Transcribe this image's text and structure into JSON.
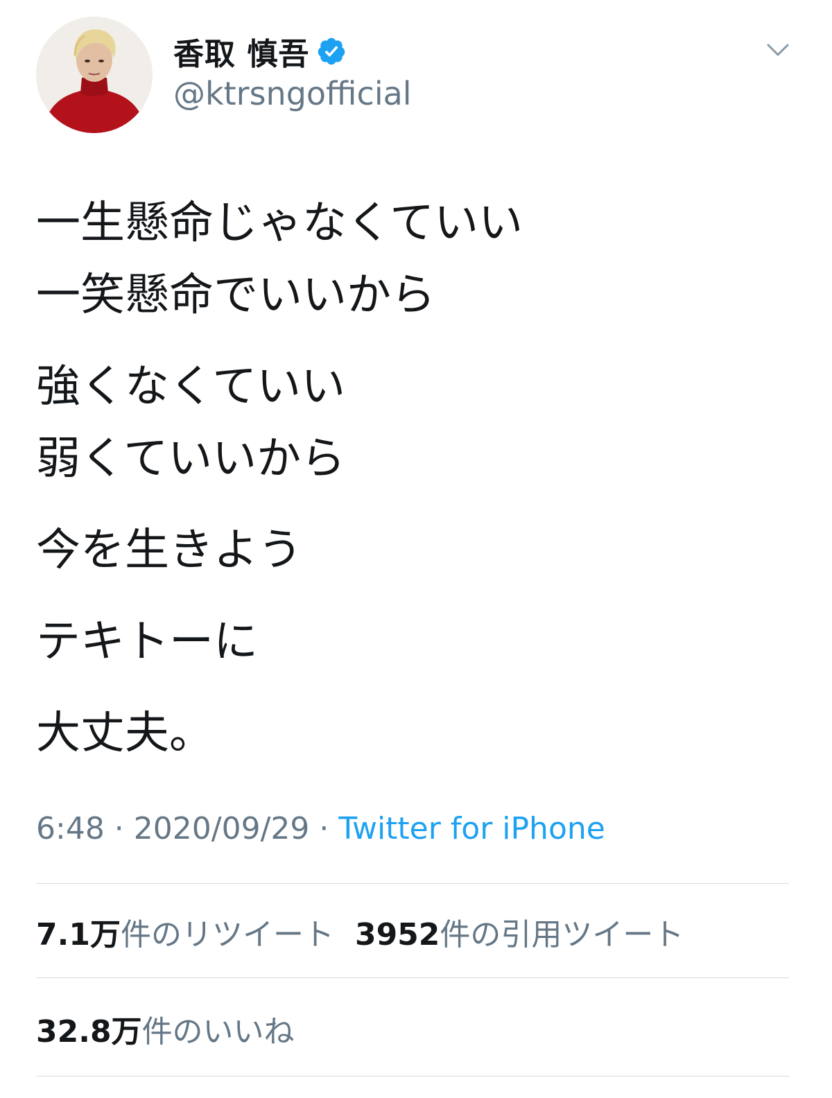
{
  "tweet": {
    "display_name": "香取 慎吾",
    "handle": "@ktrsngofficial",
    "verified_icon": "verified-badge-icon",
    "menu_icon": "chevron-down-icon",
    "body": {
      "p1": [
        "一生懸命じゃなくていい",
        "一笑懸命でいいから"
      ],
      "p2": [
        "強くなくていい",
        "弱くていいから"
      ],
      "p3": "今を生きよう",
      "p4": "テキトーに",
      "p5": "大丈夫。"
    },
    "time": "6:48",
    "date": "2020/09/29",
    "separator": " · ",
    "source": "Twitter for iPhone",
    "retweets": {
      "count": "7.1万",
      "label": "件のリツイート"
    },
    "quotes": {
      "count": "3952",
      "label": "件の引用ツイート"
    },
    "likes": {
      "count": "32.8万",
      "label": "件のいいね"
    }
  },
  "colors": {
    "text": "#14171a",
    "secondary": "#657786",
    "link": "#1da1f2",
    "divider": "#d8dde1",
    "verified": "#1da1f2"
  }
}
